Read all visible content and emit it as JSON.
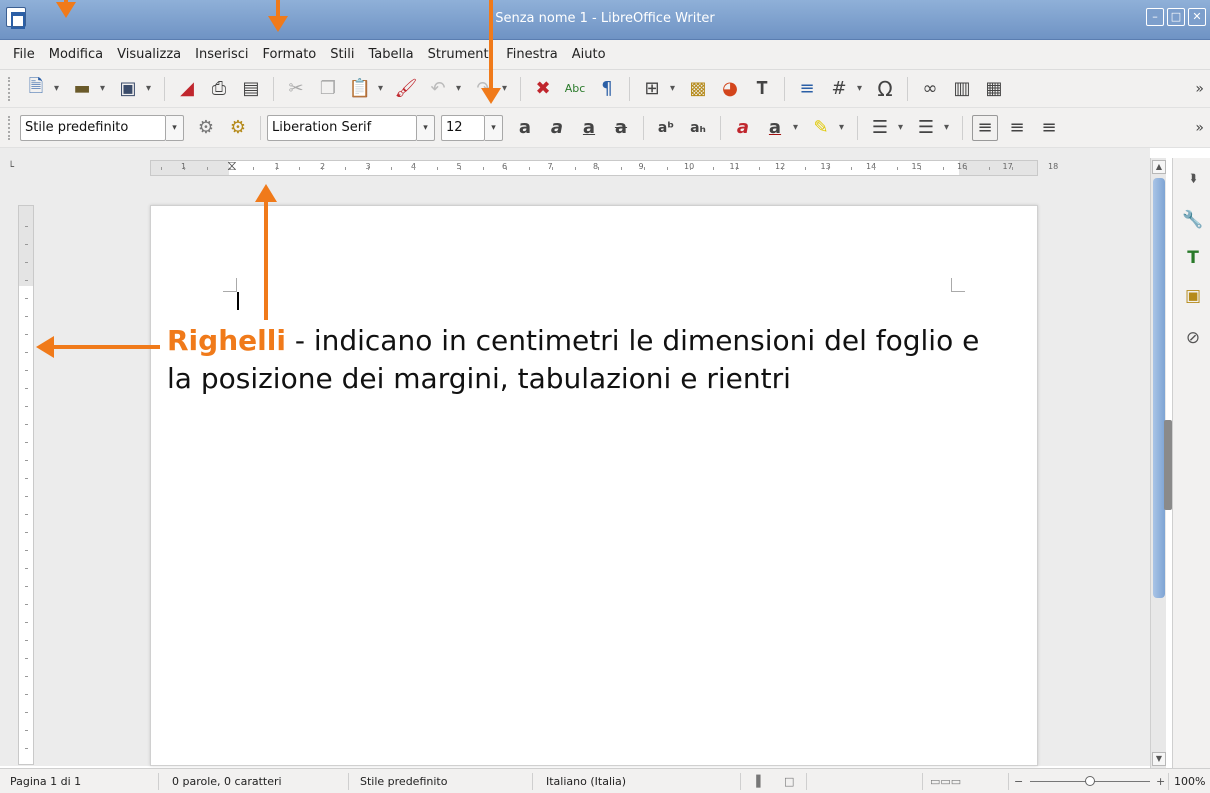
{
  "window": {
    "title": "Senza nome 1 - LibreOffice Writer",
    "controls": [
      "–",
      "□",
      "✕"
    ]
  },
  "menu": [
    "File",
    "Modifica",
    "Visualizza",
    "Inserisci",
    "Formato",
    "Stili",
    "Tabella",
    "Strumenti",
    "Finestra",
    "Aiuto"
  ],
  "toolbar2": {
    "paragraph_style": "Stile predefinito",
    "font_name": "Liberation Serif",
    "font_size": "12"
  },
  "ruler": {
    "h_numbers": [
      "1",
      "1",
      "2",
      "3",
      "4",
      "5",
      "6",
      "7",
      "8",
      "9",
      "10",
      "11",
      "12",
      "13",
      "14",
      "15",
      "16",
      "17",
      "18"
    ]
  },
  "annotation": {
    "highlight": "Righelli",
    "text": " - indicano in centimetri le dimensioni del foglio e la posizione dei margini, tabulazioni e rientri"
  },
  "status": {
    "page": "Pagina 1 di 1",
    "words": "0 parole, 0 caratteri",
    "style": "Stile predefinito",
    "language": "Italiano (Italia)",
    "zoom": "100%"
  },
  "colors": {
    "accent": "#f07a1a",
    "titlebar": "#7b9dca"
  }
}
